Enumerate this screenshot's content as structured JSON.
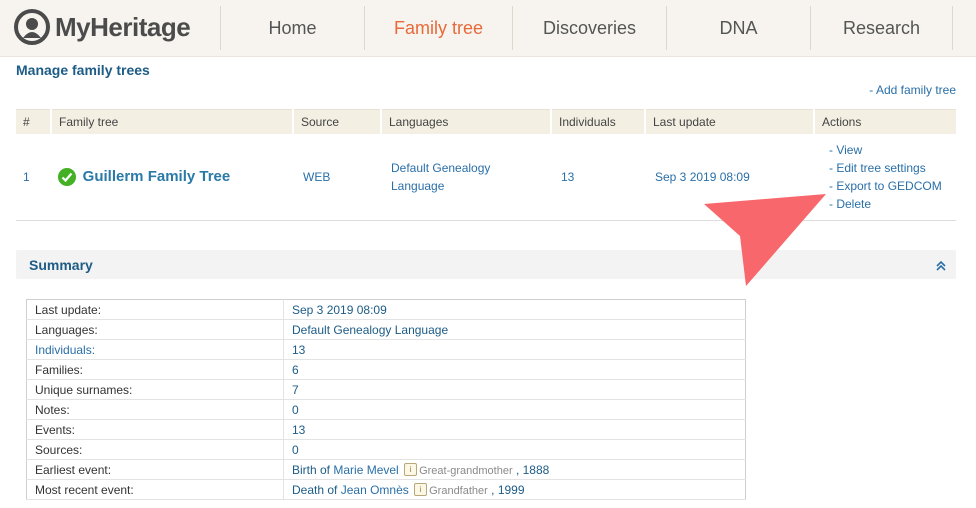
{
  "brand": {
    "name": "MyHeritage"
  },
  "nav": [
    {
      "label": "Home",
      "active": false
    },
    {
      "label": "Family tree",
      "active": true
    },
    {
      "label": "Discoveries",
      "active": false
    },
    {
      "label": "DNA",
      "active": false
    },
    {
      "label": "Research",
      "active": false
    }
  ],
  "page": {
    "title": "Manage family trees",
    "add_link": "- Add family tree"
  },
  "trees_table": {
    "headers": [
      "#",
      "Family tree",
      "Source",
      "Languages",
      "Individuals",
      "Last update",
      "Actions"
    ],
    "rows": [
      {
        "index": "1",
        "name": "Guillerm Family Tree",
        "source": "WEB",
        "language": "Default Genealogy Language",
        "individuals": "13",
        "last_update": "Sep 3 2019 08:09",
        "actions": [
          "- View",
          "- Edit tree settings",
          "- Export to GEDCOM",
          "- Delete"
        ]
      }
    ]
  },
  "summary": {
    "title": "Summary",
    "rows": [
      {
        "key": "Last update:",
        "value": "Sep 3 2019 08:09"
      },
      {
        "key": "Languages:",
        "value": "Default Genealogy Language"
      },
      {
        "key": "Individuals:",
        "value": "13"
      },
      {
        "key": "Families:",
        "value": "6"
      },
      {
        "key": "Unique surnames:",
        "value": "7"
      },
      {
        "key": "Notes:",
        "value": "0"
      },
      {
        "key": "Events:",
        "value": "13"
      },
      {
        "key": "Sources:",
        "value": "0"
      }
    ],
    "earliest": {
      "key": "Earliest event:",
      "prefix": "Birth of",
      "person": "Marie Mevel",
      "relation": "Great-grandmother",
      "year": ", 1888"
    },
    "recent": {
      "key": "Most recent event:",
      "prefix": "Death of",
      "person": "Jean Omnès",
      "relation": "Grandfather",
      "year": ", 1999"
    }
  },
  "colors": {
    "brand_orange": "#e8693a",
    "link_blue": "#2a6fa8",
    "check_green": "#44b024",
    "arrow_red": "#f8676b"
  }
}
